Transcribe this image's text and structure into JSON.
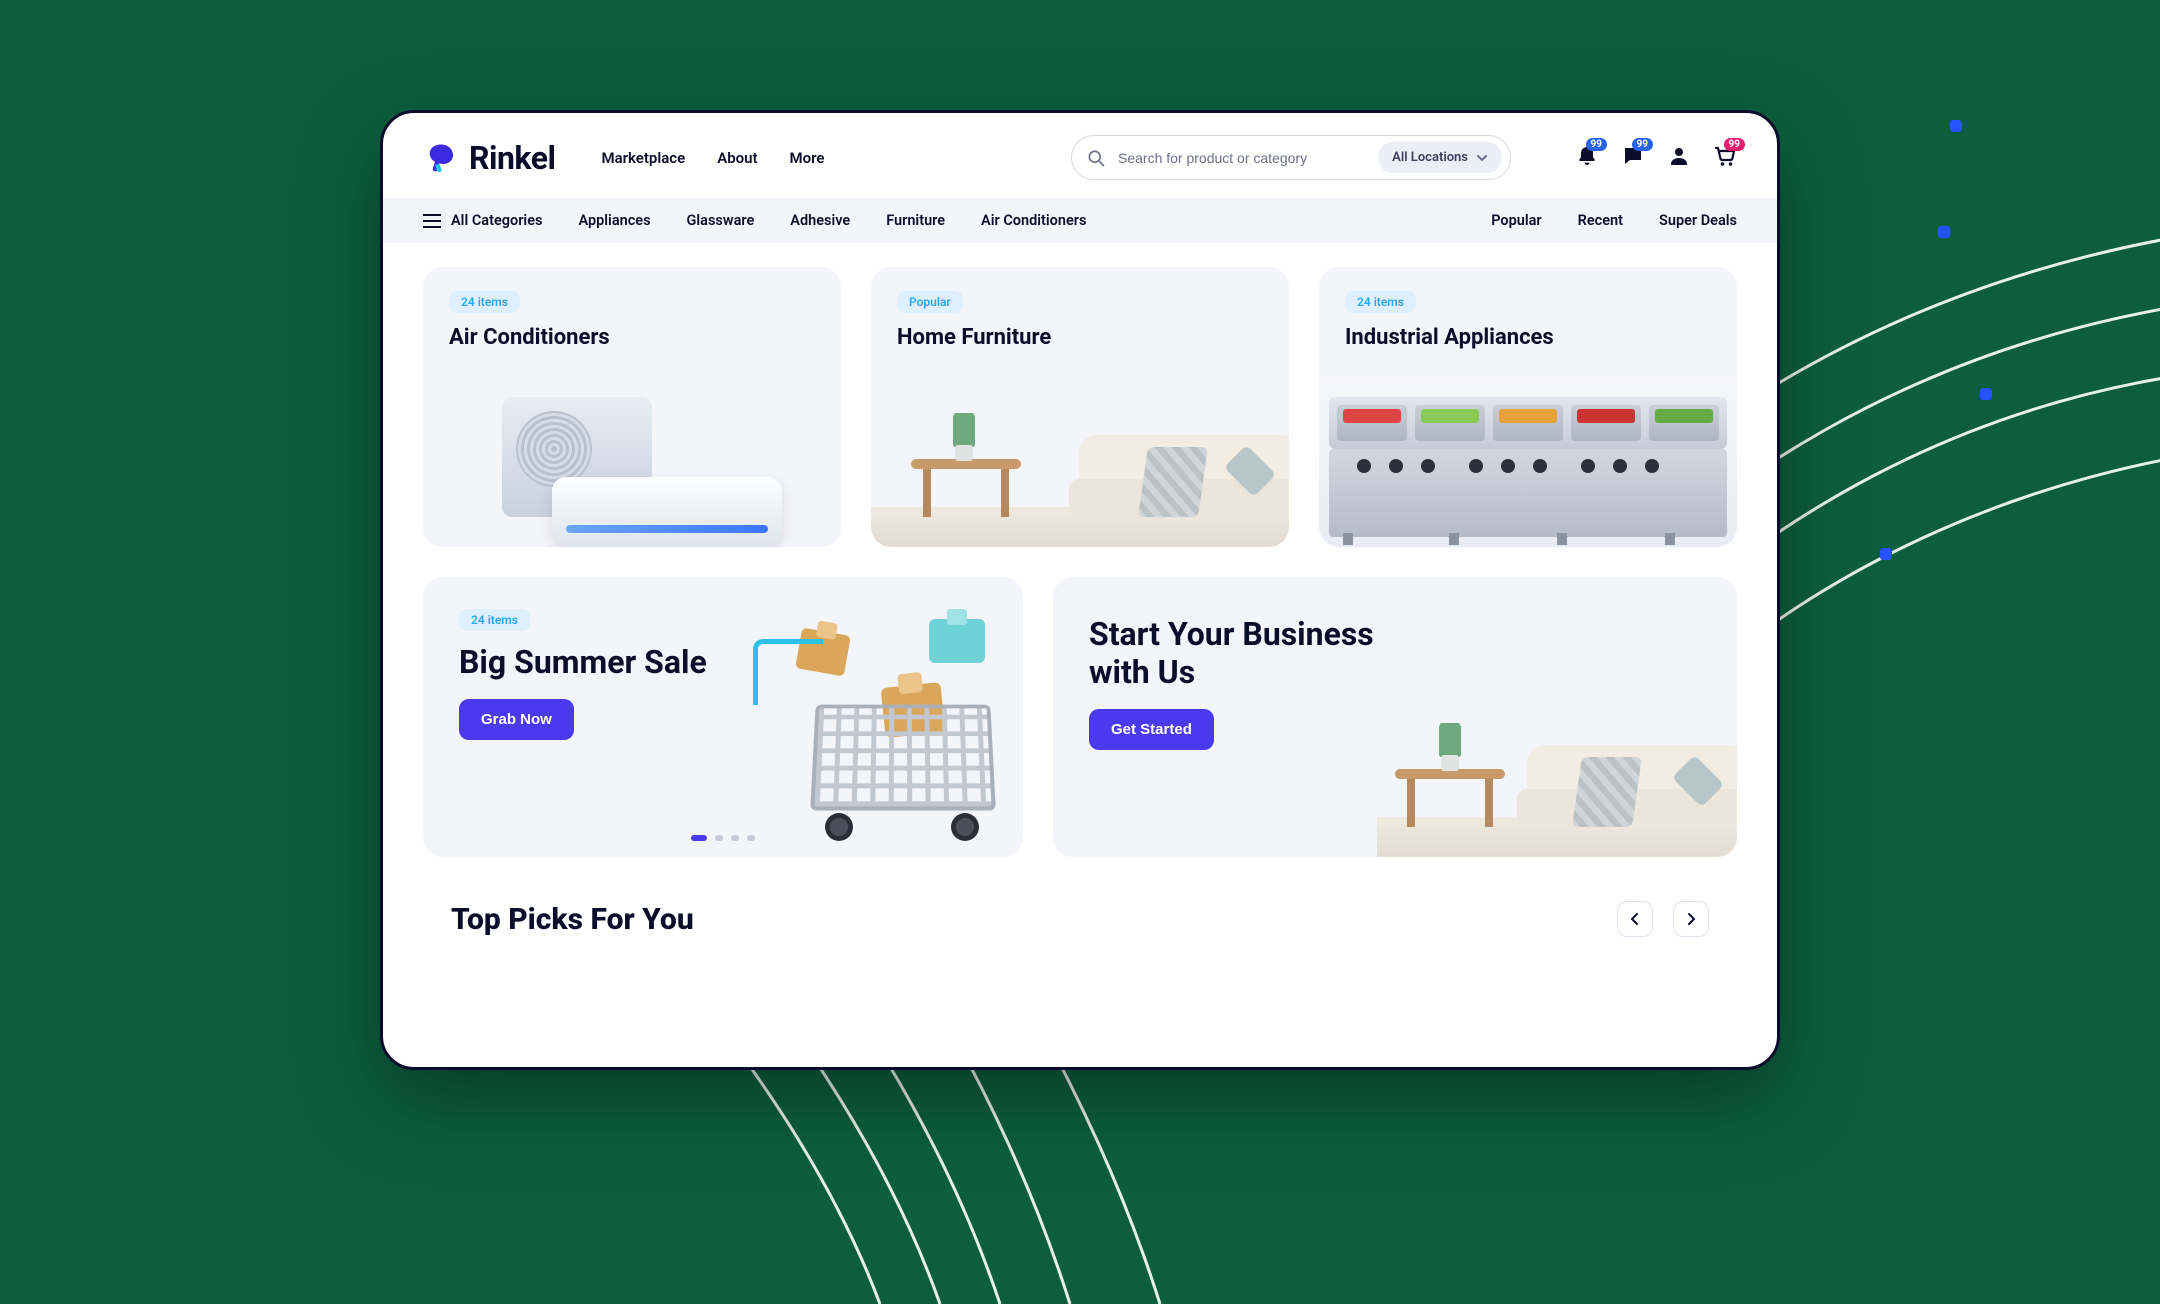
{
  "brand": {
    "name": "Rinkel"
  },
  "nav": {
    "items": [
      "Marketplace",
      "About",
      "More"
    ]
  },
  "search": {
    "placeholder": "Search for product or category",
    "location_label": "All Locations"
  },
  "header_badges": {
    "bell": "99",
    "chat": "99",
    "cart": "99"
  },
  "subnav": {
    "all": "All Categories",
    "tabs": [
      "Appliances",
      "Glassware",
      "Adhesive",
      "Furniture",
      "Air Conditioners"
    ],
    "right": [
      "Popular",
      "Recent",
      "Super Deals"
    ]
  },
  "cards": [
    {
      "chip": "24 items",
      "title": "Air Conditioners"
    },
    {
      "chip": "Popular",
      "title": "Home Furniture"
    },
    {
      "chip": "24 items",
      "title": "Industrial Appliances"
    }
  ],
  "banner_sale": {
    "chip": "24 items",
    "title": "Big Summer Sale",
    "cta": "Grab Now"
  },
  "banner_biz": {
    "title_line1": "Start Your Business",
    "title_line2": "with Us",
    "cta": "Get Started"
  },
  "section": {
    "top_picks": "Top Picks For You"
  }
}
